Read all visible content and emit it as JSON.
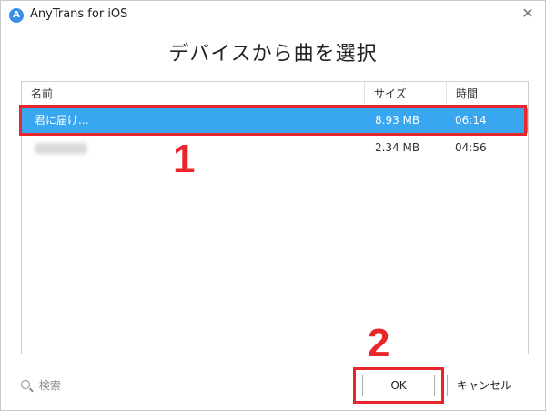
{
  "window": {
    "app_title": "AnyTrans for iOS",
    "app_icon_glyph": "A",
    "close_glyph": "✕"
  },
  "dialog": {
    "heading": "デバイスから曲を選択"
  },
  "table": {
    "columns": [
      "名前",
      "サイズ",
      "時間"
    ],
    "rows": [
      {
        "name": "君に届け...",
        "size": "8.93 MB",
        "time": "06:14",
        "selected": true
      },
      {
        "name": "",
        "size": "2.34 MB",
        "time": "04:56",
        "selected": false
      }
    ]
  },
  "footer": {
    "search_label": "検索",
    "ok_label": "OK",
    "cancel_label": "キャンセル"
  },
  "annotations": {
    "step1": "1",
    "step2": "2"
  },
  "colors": {
    "selection": "#38a7f0",
    "annotation": "#e8262c"
  }
}
